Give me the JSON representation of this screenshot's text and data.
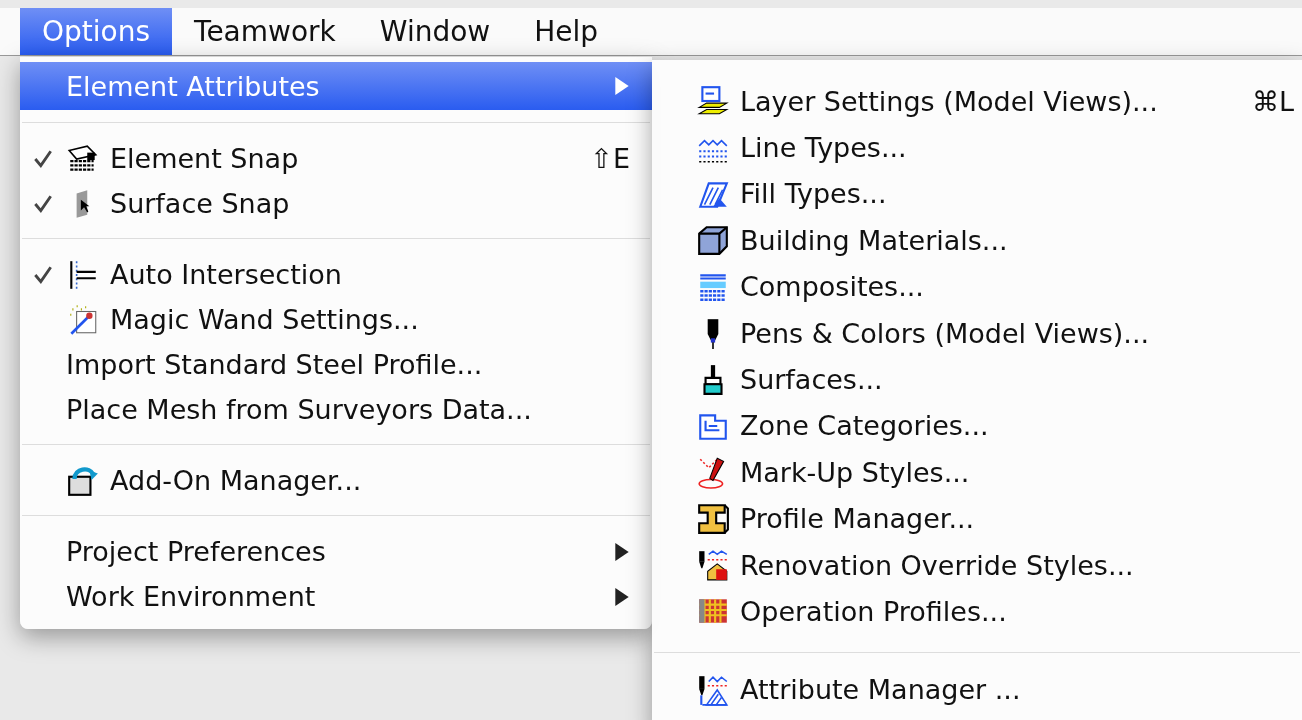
{
  "menubar": [
    {
      "label": "Options",
      "selected": true
    },
    {
      "label": "Teamwork",
      "selected": false
    },
    {
      "label": "Window",
      "selected": false
    },
    {
      "label": "Help",
      "selected": false
    }
  ],
  "options_menu": {
    "items": [
      {
        "kind": "item",
        "label": "Element Attributes",
        "selected": true,
        "checked": false,
        "submenu": true
      },
      {
        "kind": "separator"
      },
      {
        "kind": "item",
        "label": "Element Snap",
        "selected": false,
        "checked": true,
        "shortcut": "⇧E",
        "submenu": false
      },
      {
        "kind": "item",
        "label": "Surface Snap",
        "selected": false,
        "checked": true,
        "submenu": false
      },
      {
        "kind": "separator"
      },
      {
        "kind": "item",
        "label": "Auto Intersection",
        "selected": false,
        "checked": true,
        "submenu": false
      },
      {
        "kind": "item",
        "label": "Magic Wand Settings...",
        "selected": false,
        "checked": false,
        "submenu": false
      },
      {
        "kind": "item",
        "label": "Import Standard Steel Profile...",
        "selected": false,
        "checked": false,
        "submenu": false
      },
      {
        "kind": "item",
        "label": "Place Mesh from Surveyors Data...",
        "selected": false,
        "checked": false,
        "submenu": false
      },
      {
        "kind": "separator"
      },
      {
        "kind": "item",
        "label": "Add-On Manager...",
        "selected": false,
        "checked": false,
        "submenu": false
      },
      {
        "kind": "separator"
      },
      {
        "kind": "item",
        "label": "Project Preferences",
        "selected": false,
        "checked": false,
        "submenu": true
      },
      {
        "kind": "item",
        "label": "Work Environment",
        "selected": false,
        "checked": false,
        "submenu": true
      }
    ]
  },
  "element_attributes_submenu": {
    "items": [
      {
        "kind": "item",
        "label": "Layer Settings (Model Views)...",
        "shortcut": "⌘L"
      },
      {
        "kind": "item",
        "label": "Line Types..."
      },
      {
        "kind": "item",
        "label": "Fill Types..."
      },
      {
        "kind": "item",
        "label": "Building Materials..."
      },
      {
        "kind": "item",
        "label": "Composites..."
      },
      {
        "kind": "item",
        "label": "Pens & Colors (Model Views)..."
      },
      {
        "kind": "item",
        "label": "Surfaces..."
      },
      {
        "kind": "item",
        "label": "Zone Categories..."
      },
      {
        "kind": "item",
        "label": "Mark-Up Styles..."
      },
      {
        "kind": "item",
        "label": "Profile Manager..."
      },
      {
        "kind": "item",
        "label": "Renovation Override Styles..."
      },
      {
        "kind": "item",
        "label": "Operation Profiles..."
      },
      {
        "kind": "separator"
      },
      {
        "kind": "item",
        "label": "Attribute Manager ..."
      }
    ]
  }
}
